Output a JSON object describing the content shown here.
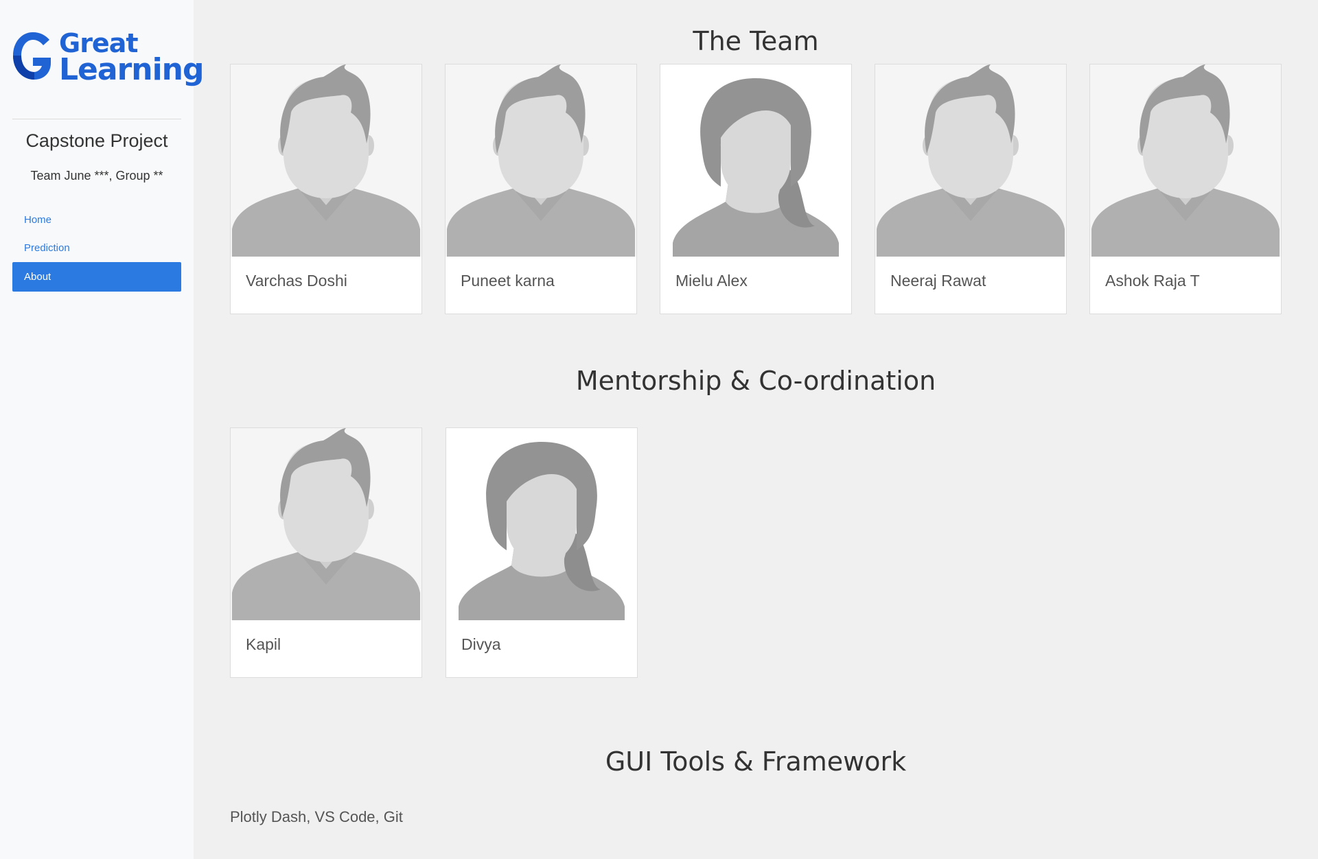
{
  "logo": {
    "line1": "Great",
    "line2": "Learning",
    "brand_color": "#1f63d4"
  },
  "sidebar": {
    "title": "Capstone Project",
    "subtitle": "Team June ***, Group **",
    "nav": [
      {
        "label": "Home",
        "active": false
      },
      {
        "label": "Prediction",
        "active": false
      },
      {
        "label": "About",
        "active": true
      }
    ],
    "accent_color": "#2a7ae2"
  },
  "sections": {
    "team_title": "The Team",
    "mentors_title": "Mentorship & Co-ordination",
    "tools_title": "GUI Tools & Framework",
    "tools_text": "Plotly Dash, VS Code, Git"
  },
  "team": [
    {
      "name": "Varchas Doshi",
      "avatar": "male-avatar-icon"
    },
    {
      "name": "Puneet karna",
      "avatar": "male-avatar-icon"
    },
    {
      "name": "Mielu Alex",
      "avatar": "female-avatar-icon"
    },
    {
      "name": "Neeraj Rawat",
      "avatar": "male-avatar-icon"
    },
    {
      "name": "Ashok Raja T",
      "avatar": "male-avatar-icon"
    }
  ],
  "mentors": [
    {
      "name": "Kapil",
      "avatar": "male-avatar-icon"
    },
    {
      "name": "Divya",
      "avatar": "female-avatar-icon"
    }
  ]
}
